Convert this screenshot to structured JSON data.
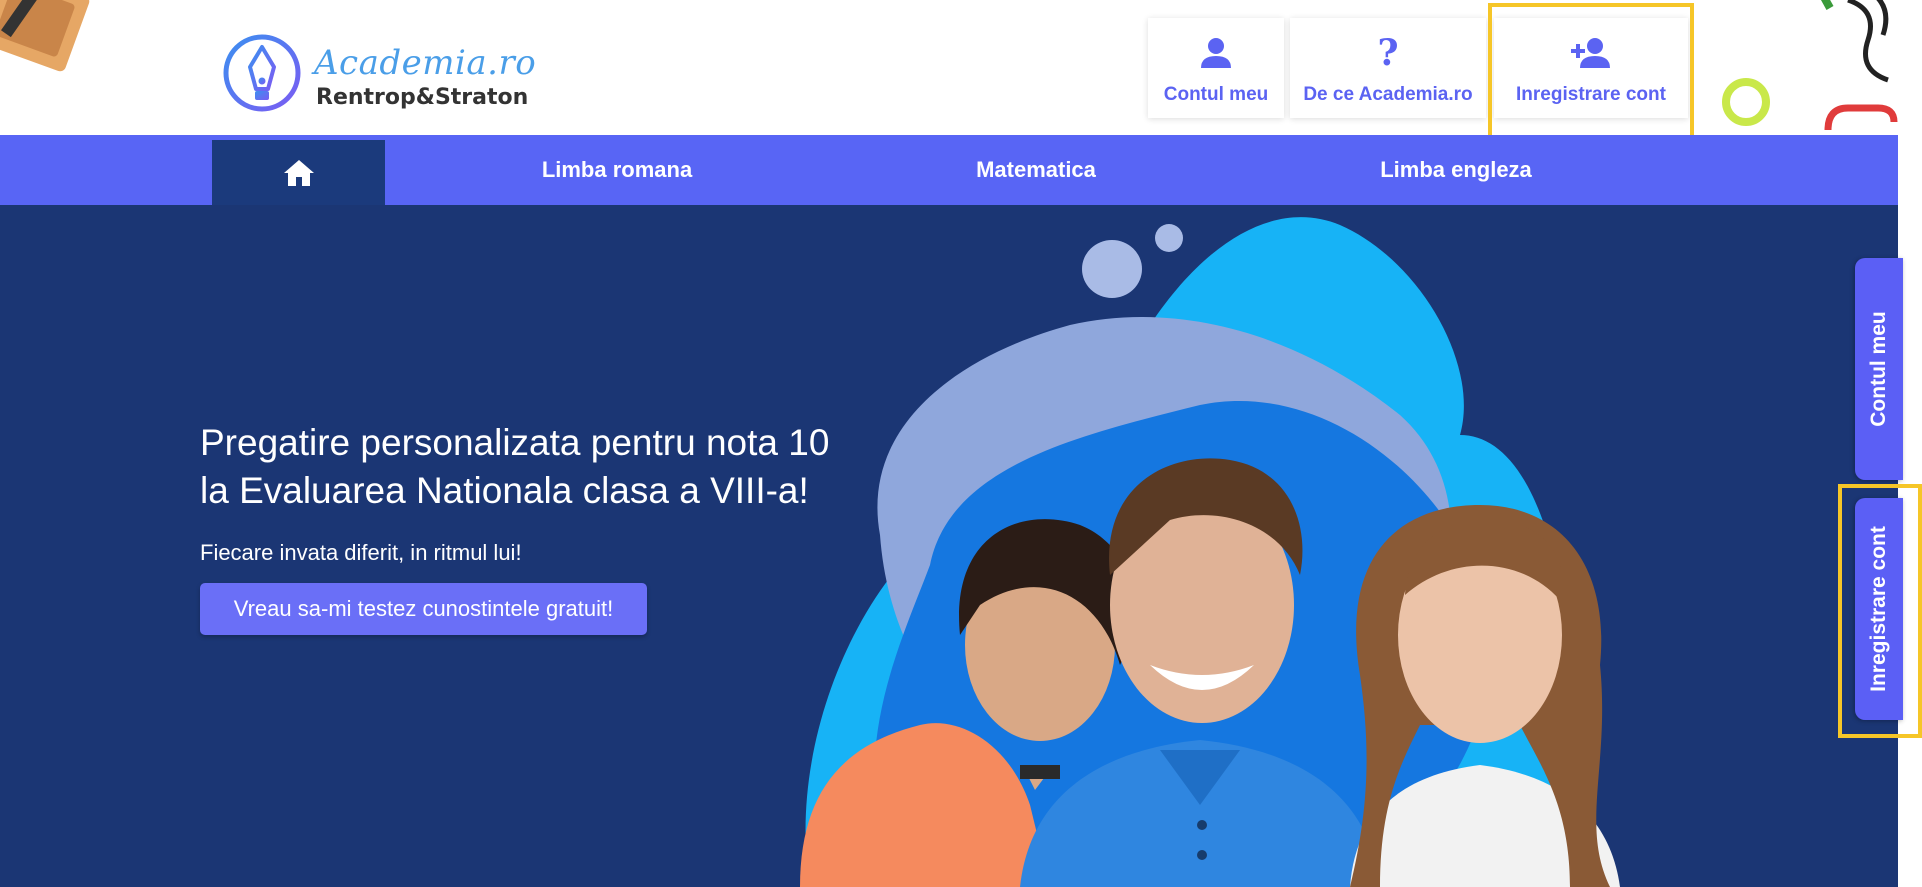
{
  "brand": {
    "script_name": "Academia.ro",
    "company_name": "Rentrop&Straton"
  },
  "header": {
    "buttons": [
      {
        "label": "Contul meu",
        "icon": "user-icon"
      },
      {
        "label": "De ce Academia.ro",
        "icon": "question-icon"
      },
      {
        "label": "Inregistrare cont",
        "icon": "add-user-icon"
      }
    ],
    "question_glyph": "?"
  },
  "nav": {
    "home_icon": "home-icon",
    "items": [
      "Limba romana",
      "Matematica",
      "Limba engleza"
    ]
  },
  "hero": {
    "title_line1": "Pregatire personalizata pentru nota 10",
    "title_line2": "la Evaluarea Nationala clasa a VIII-a!",
    "subtitle": "Fiecare invata diferit, in ritmul lui!",
    "cta_label": "Vreau sa-mi testez cunostintele gratuit!"
  },
  "side_tabs": [
    "Contul meu",
    "Inregistrare cont"
  ],
  "colors": {
    "accent": "#5865f5",
    "hero_bg": "#1b3674",
    "highlight": "#f6c628",
    "text_accent": "#5b63f2"
  }
}
